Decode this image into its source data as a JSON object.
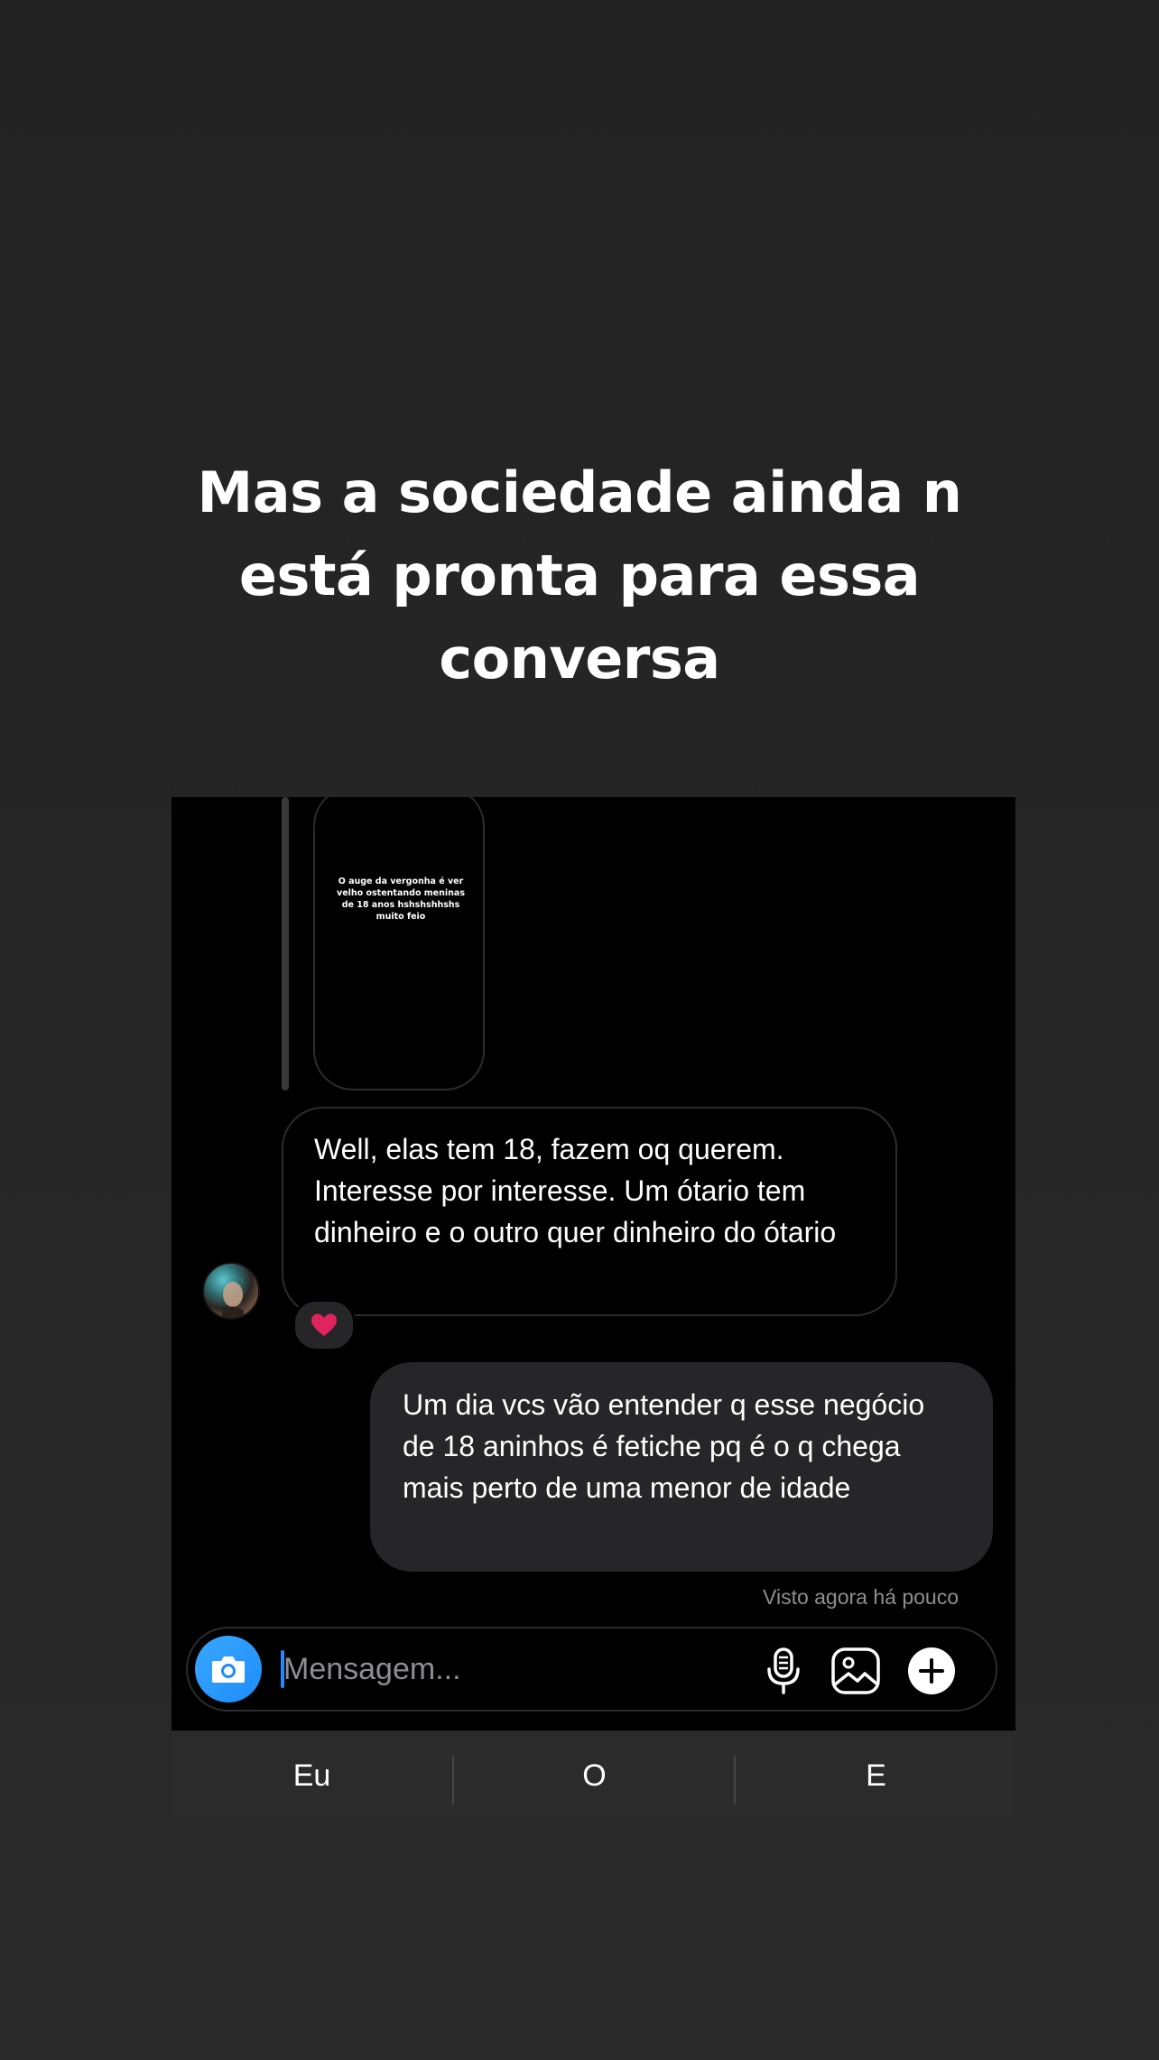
{
  "headline": {
    "line1": "Mas a sociedade ainda n",
    "line2": "está pronta para essa",
    "line3": "conversa"
  },
  "chat": {
    "replied_story_text": "O auge da vergonha é ver velho ostentando meninas de 18 anos hshshshhshs muito feio",
    "incoming_message": "Well, elas tem 18, fazem oq querem. Interesse por interesse. Um ótario tem dinheiro e o outro quer dinheiro do ótario",
    "reaction": "❤️",
    "outgoing_message": "Um dia vcs vão entender q esse negócio de 18 aninhos é fetiche pq é o q chega mais perto de uma menor de idade",
    "seen_status": "Visto agora há pouco"
  },
  "composer": {
    "placeholder": "Mensagem...",
    "icons": [
      "camera-icon",
      "microphone-icon",
      "gallery-icon",
      "plus-icon"
    ]
  },
  "keyboard_suggestions": [
    "Eu",
    "O",
    "E"
  ],
  "colors": {
    "background": "#252526",
    "chat_background": "#000000",
    "outgoing_bubble": "#262628",
    "accent_blue": "#1d8cf8",
    "heart": "#e0245e"
  }
}
